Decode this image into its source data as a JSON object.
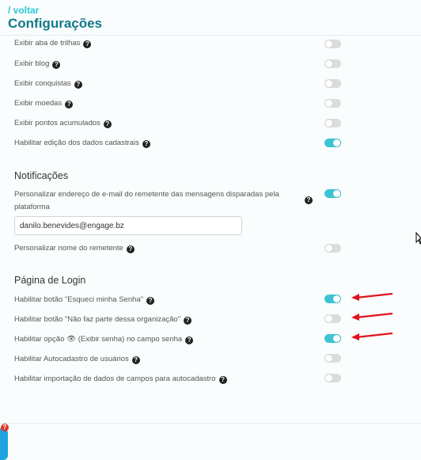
{
  "header": {
    "back_label": "/ voltar",
    "title": "Configurações"
  },
  "help_glyph": "?",
  "general": [
    {
      "label": "Exibir aba de trilhas",
      "enabled": false
    },
    {
      "label": "Exibir blog",
      "enabled": false
    },
    {
      "label": "Exibir conquistas",
      "enabled": false
    },
    {
      "label": "Exibir moedas",
      "enabled": false
    },
    {
      "label": "Exibir pontos acumulados",
      "enabled": false
    },
    {
      "label": "Habilitar edição dos dados cadastrais",
      "enabled": true
    }
  ],
  "notificacoes": {
    "title": "Notificações",
    "custom_email": {
      "label": "Personalizar endereço de e-mail do remetente das mensagens disparadas pela plataforma",
      "enabled": true
    },
    "email_value": "danilo.benevides@engage.bz",
    "custom_sender": {
      "label": "Personalizar nome do remetente",
      "enabled": false
    }
  },
  "login": {
    "title": "Página de Login",
    "items": [
      {
        "label": "Habilitar botão \"Esqueci minha Senha\"",
        "enabled": true
      },
      {
        "label": "Habilitar botão \"Não faz parte dessa organização\"",
        "enabled": false
      },
      {
        "label": "Habilitar opção 👁 (Exibir senha) no campo senha",
        "enabled": true
      },
      {
        "label": "Habilitar Autocadastro de usuários",
        "enabled": false
      },
      {
        "label": "Habilitar importação de dados de campos para autocadastro",
        "enabled": false
      }
    ]
  },
  "bottom_badge": "?",
  "colors": {
    "accent": "#3cc4d6",
    "title": "#137a8a",
    "annotation_arrow": "#e0141e"
  }
}
